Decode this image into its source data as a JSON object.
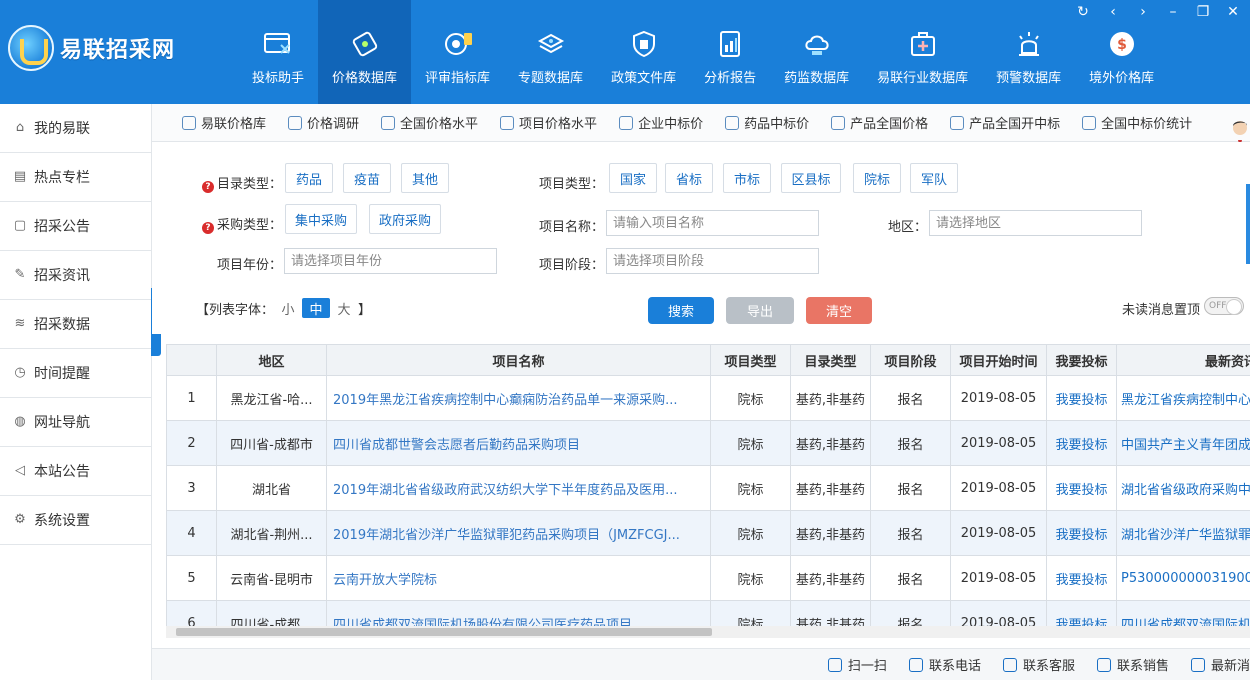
{
  "app": {
    "logo_text": "易联招采网",
    "nav": [
      {
        "label": "投标助手",
        "icon": "bid-assistant-icon"
      },
      {
        "label": "价格数据库",
        "icon": "price-database-icon",
        "active": true
      },
      {
        "label": "评审指标库",
        "icon": "review-indicator-icon"
      },
      {
        "label": "专题数据库",
        "icon": "topic-database-icon"
      },
      {
        "label": "政策文件库",
        "icon": "policy-file-icon"
      },
      {
        "label": "分析报告",
        "icon": "analysis-report-icon"
      },
      {
        "label": "药监数据库",
        "icon": "drug-supervision-icon"
      },
      {
        "label": "易联行业数据库",
        "icon": "industry-database-icon"
      },
      {
        "label": "预警数据库",
        "icon": "warning-database-icon"
      },
      {
        "label": "境外价格库",
        "icon": "overseas-price-icon"
      }
    ]
  },
  "sidebar": {
    "items": [
      {
        "label": "我的易联",
        "icon": "home-icon"
      },
      {
        "label": "热点专栏",
        "icon": "hot-column-icon"
      },
      {
        "label": "招采公告",
        "icon": "announcement-icon"
      },
      {
        "label": "招采资讯",
        "icon": "news-icon"
      },
      {
        "label": "招采数据",
        "icon": "data-layers-icon"
      },
      {
        "label": "时间提醒",
        "icon": "clock-icon"
      },
      {
        "label": "网址导航",
        "icon": "globe-icon"
      },
      {
        "label": "本站公告",
        "icon": "speaker-icon"
      },
      {
        "label": "系统设置",
        "icon": "gear-icon"
      }
    ]
  },
  "subnav": {
    "items": [
      {
        "label": "易联价格库"
      },
      {
        "label": "价格调研"
      },
      {
        "label": "全国价格水平"
      },
      {
        "label": "项目价格水平"
      },
      {
        "label": "企业中标价"
      },
      {
        "label": "药品中标价"
      },
      {
        "label": "产品全国价格"
      },
      {
        "label": "产品全国开中标"
      },
      {
        "label": "全国中标价统计"
      }
    ]
  },
  "filters": {
    "catalog_type_label": "目录类型：",
    "catalog_types": [
      "药品",
      "疫苗",
      "其他"
    ],
    "project_type_label": "项目类型：",
    "project_types": [
      "国家",
      "省标",
      "市标",
      "区县标",
      "院标",
      "军队"
    ],
    "purchase_type_label": "采购类型：",
    "purchase_types": [
      "集中采购",
      "政府采购"
    ],
    "project_name_label": "项目名称：",
    "project_name_placeholder": "请输入项目名称",
    "region_label": "地区：",
    "region_placeholder": "请选择地区",
    "project_year_label": "项目年份：",
    "project_year_placeholder": "请选择项目年份",
    "project_stage_label": "项目阶段：",
    "project_stage_placeholder": "请选择项目阶段",
    "font_size_open": "【列表字体：",
    "font_sizes": [
      "小",
      "中",
      "大"
    ],
    "font_size_selected": "中",
    "font_size_close": "】",
    "search_label": "搜索",
    "export_label": "导出",
    "clear_label": "清空",
    "unread_pin_label": "未读消息置顶",
    "toggle_text": "OFF"
  },
  "colors": {
    "primary": "#1a7fd9",
    "search_button": "#1a7fd9",
    "export_button": "#b9c0c7",
    "clear_button": "#e97565"
  },
  "table": {
    "columns": [
      "",
      "地区",
      "项目名称",
      "项目类型",
      "目录类型",
      "项目阶段",
      "项目开始时间",
      "我要投标",
      "最新资讯"
    ],
    "rows": [
      {
        "no": "1",
        "region": "黑龙江省-哈...",
        "name": "2019年黑龙江省疾病控制中心癫痫防治药品单一来源采购...",
        "ptype": "院标",
        "ctype": "基药,非基药",
        "stage": "报名",
        "date": "2019-08-05",
        "bid": "我要投标",
        "news": "黑龙江省疾病控制中心"
      },
      {
        "no": "2",
        "region": "四川省-成都市",
        "name": "四川省成都世警会志愿者后勤药品采购项目",
        "ptype": "院标",
        "ctype": "基药,非基药",
        "stage": "报名",
        "date": "2019-08-05",
        "bid": "我要投标",
        "news": "中国共产主义青年团成"
      },
      {
        "no": "3",
        "region": "湖北省",
        "name": "2019年湖北省省级政府武汉纺织大学下半年度药品及医用...",
        "ptype": "院标",
        "ctype": "基药,非基药",
        "stage": "报名",
        "date": "2019-08-05",
        "bid": "我要投标",
        "news": "湖北省省级政府采购中"
      },
      {
        "no": "4",
        "region": "湖北省-荆州...",
        "name": "2019年湖北省沙洋广华监狱罪犯药品采购项目（JMZFCGJ...",
        "ptype": "院标",
        "ctype": "基药,非基药",
        "stage": "报名",
        "date": "2019-08-05",
        "bid": "我要投标",
        "news": "湖北省沙洋广华监狱罪"
      },
      {
        "no": "5",
        "region": "云南省-昆明市",
        "name": "云南开放大学院标",
        "ptype": "院标",
        "ctype": "基药,非基药",
        "stage": "报名",
        "date": "2019-08-05",
        "bid": "我要投标",
        "news": "P5300000000319000"
      },
      {
        "no": "6",
        "region": "四川省-成都...",
        "name": "四川省成都双流国际机场股份有限公司医疗药品项目",
        "ptype": "院标",
        "ctype": "基药,非基药",
        "stage": "报名",
        "date": "2019-08-05",
        "bid": "我要投标",
        "news": "四川省成都双流国际机"
      }
    ]
  },
  "bottombar": {
    "items": [
      {
        "label": "扫一扫",
        "icon": "qr-code-icon"
      },
      {
        "label": "联系电话",
        "icon": "phone-icon"
      },
      {
        "label": "联系客服",
        "icon": "customer-service-icon"
      },
      {
        "label": "联系销售",
        "icon": "sales-icon"
      },
      {
        "label": "最新消",
        "icon": "message-icon"
      }
    ]
  }
}
